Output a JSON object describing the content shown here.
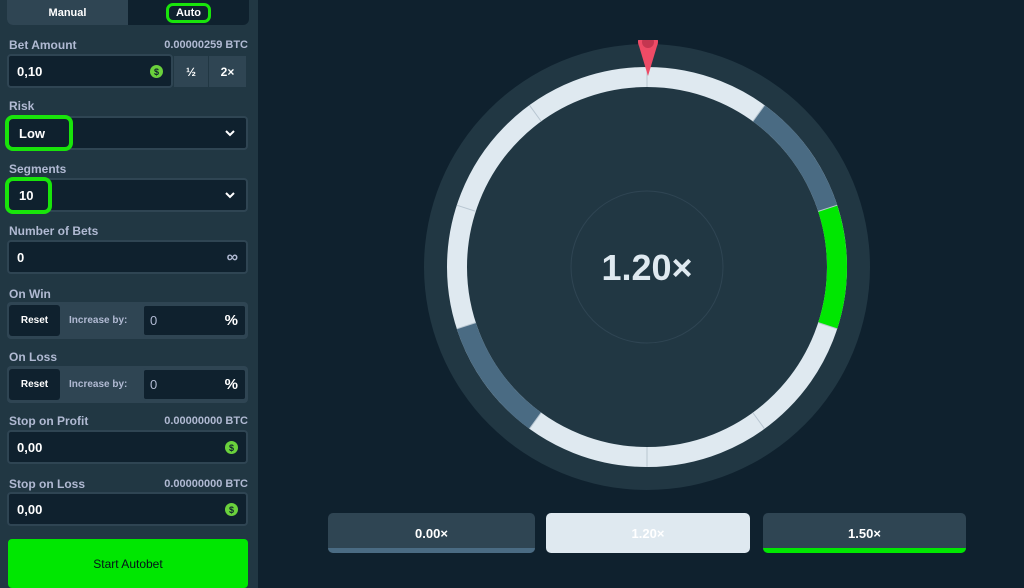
{
  "sidebar": {
    "tabs": {
      "manual": "Manual",
      "auto": "Auto"
    },
    "bet_amount": {
      "label": "Bet Amount",
      "btc": "0.00000259 BTC",
      "value": "0,10",
      "half": "½",
      "double": "2×"
    },
    "risk": {
      "label": "Risk",
      "value": "Low"
    },
    "segments": {
      "label": "Segments",
      "value": "10"
    },
    "number_of_bets": {
      "label": "Number of Bets",
      "value": "0",
      "infinity": "∞"
    },
    "on_win": {
      "label": "On Win",
      "reset": "Reset",
      "increase": "Increase by:",
      "value": "0",
      "pct": "%"
    },
    "on_loss": {
      "label": "On Loss",
      "reset": "Reset",
      "increase": "Increase by:",
      "value": "0",
      "pct": "%"
    },
    "stop_profit": {
      "label": "Stop on Profit",
      "btc": "0.00000000 BTC",
      "value": "0,00"
    },
    "stop_loss": {
      "label": "Stop on Loss",
      "btc": "0.00000000 BTC",
      "value": "0,00"
    },
    "start": "Start Autobet",
    "coin_symbol": "$"
  },
  "game": {
    "multiplier": "1.20×",
    "chips": [
      {
        "label": "0.00×",
        "color": "#4a6b83"
      },
      {
        "label": "1.20×",
        "color": "#dfe9f0"
      },
      {
        "label": "1.50×",
        "color": "#00e701"
      }
    ]
  },
  "colors": {
    "accent": "#00e701",
    "highlight": "#19e40b",
    "pointer": "#ee4b66"
  }
}
